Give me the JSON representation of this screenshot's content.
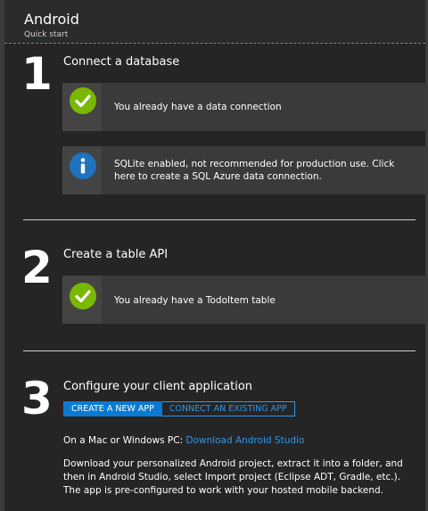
{
  "header": {
    "title": "Android",
    "subtitle": "Quick start"
  },
  "steps": [
    {
      "number": "1",
      "title": "Connect a database",
      "notices": [
        {
          "icon": "check-icon",
          "text": "You already have a data connection"
        },
        {
          "icon": "info-icon",
          "text": "SQLite enabled, not recommended for production use.  Click here to create a SQL Azure data connection."
        }
      ]
    },
    {
      "number": "2",
      "title": "Create a table API",
      "notices": [
        {
          "icon": "check-icon",
          "text": "You already have a TodoItem table"
        }
      ]
    },
    {
      "number": "3",
      "title": "Configure your client application",
      "tabs": [
        {
          "label": "CREATE A NEW APP",
          "selected": true
        },
        {
          "label": "CONNECT AN EXISTING APP",
          "selected": false
        }
      ],
      "platform_label": "On a Mac or Windows PC:",
      "download_link": "Download Android Studio",
      "instructions": "Download your personalized Android project, extract it into a folder, and then in Android Studio, select Import project (Eclipse ADT, Gradle, etc.). The app is pre-configured to work with your hosted mobile backend."
    }
  ],
  "colors": {
    "background": "#252526",
    "panel": "#3a3a3a",
    "success": "#7ab800",
    "info": "#1e73be",
    "accent": "#0a7ad1",
    "link": "#2f97e8"
  }
}
